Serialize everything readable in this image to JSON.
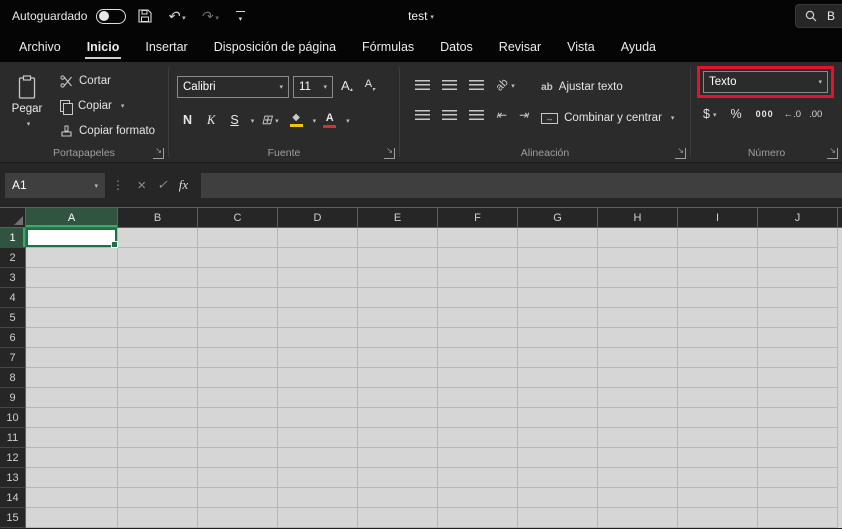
{
  "colors": {
    "accent_green": "#217346",
    "selection_green": "#1E7145",
    "annotation_red": "#E8112D",
    "fill_yellow": "#F2C40F",
    "font_red": "#D0342C"
  },
  "titlebar": {
    "autosave_label": "Autoguardado",
    "document_title": "test",
    "search_text": "B"
  },
  "tabs": [
    {
      "label": "Archivo"
    },
    {
      "label": "Inicio"
    },
    {
      "label": "Insertar"
    },
    {
      "label": "Disposición de página"
    },
    {
      "label": "Fórmulas"
    },
    {
      "label": "Datos"
    },
    {
      "label": "Revisar"
    },
    {
      "label": "Vista"
    },
    {
      "label": "Ayuda"
    }
  ],
  "ribbon": {
    "clipboard": {
      "label": "Portapapeles",
      "paste": "Pegar",
      "cut": "Cortar",
      "copy": "Copiar",
      "format_painter": "Copiar formato"
    },
    "font": {
      "label": "Fuente",
      "family": "Calibri",
      "size": "11",
      "bold": "N",
      "italic": "K",
      "underline": "S",
      "grow_font": "A",
      "shrink_font": "A"
    },
    "alignment": {
      "label": "Alineación",
      "orientation_glyph": "ab",
      "wrap_icon_glyph": "ab",
      "wrap_text": "Ajustar texto",
      "merge_center": "Combinar y centrar"
    },
    "number": {
      "label": "Número",
      "format_value": "Texto",
      "currency": "$",
      "percent": "%",
      "thousands": "000",
      "increase_decimal": "←.0",
      "decrease_decimal": ".00"
    }
  },
  "formula_bar": {
    "name_box": "A1",
    "fx": "fx",
    "formula": ""
  },
  "grid": {
    "columns": [
      "A",
      "B",
      "C",
      "D",
      "E",
      "F",
      "G",
      "H",
      "I",
      "J"
    ],
    "rows": [
      "1",
      "2",
      "3",
      "4",
      "5",
      "6",
      "7",
      "8",
      "9",
      "10",
      "11",
      "12",
      "13",
      "14",
      "15"
    ],
    "selected_cell": "A1",
    "selected_column": "A",
    "selected_row": "1"
  }
}
